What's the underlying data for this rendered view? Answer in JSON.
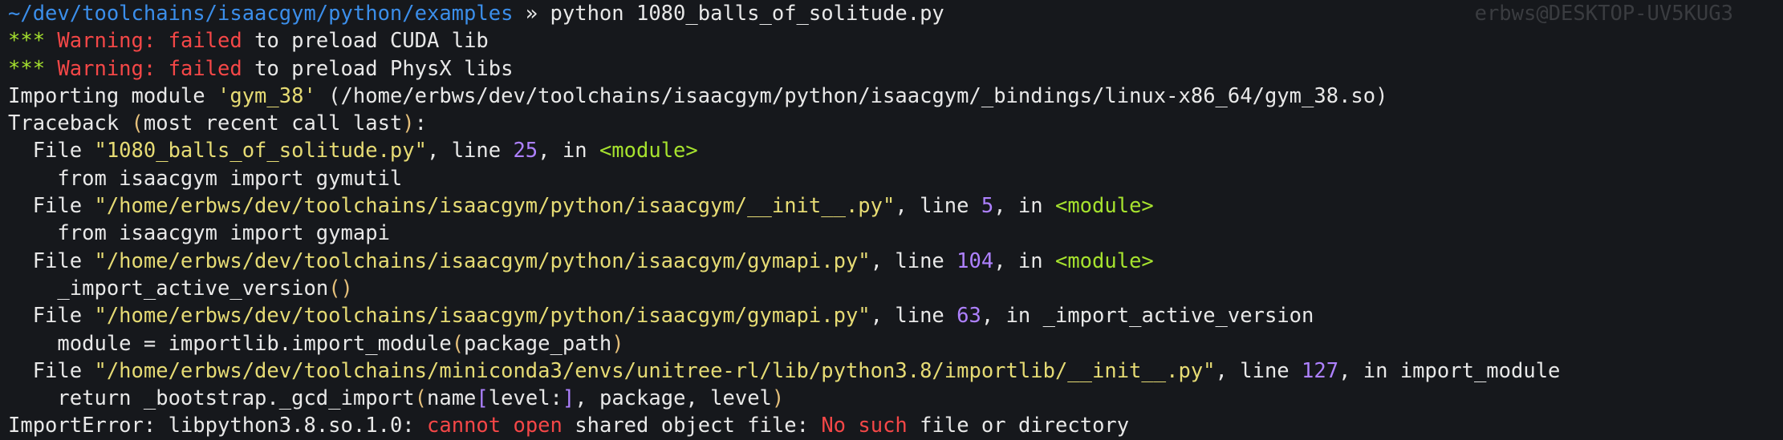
{
  "window": {
    "hostname": "erbws@DESKTOP-UV5KUG3"
  },
  "colors": {
    "background": "#16181c",
    "text": "#e8e8e8",
    "path": "#3b8eea",
    "asterisks": "#a6e22e",
    "error": "#f44747",
    "yellow": "#e5c07b",
    "string": "#e6db74",
    "number": "#ae81ff"
  },
  "prompt": {
    "cwd": "~/dev/toolchains/isaacgym/python/examples",
    "symbol": " » ",
    "command": "python 1080_balls_of_solitude.py"
  },
  "warnings": [
    {
      "stars": "***",
      "label": "Warning:",
      "keyword": "failed",
      "message": "to preload CUDA lib"
    },
    {
      "stars": "***",
      "label": "Warning:",
      "keyword": "failed",
      "message": "to preload PhysX libs"
    }
  ],
  "import_line": {
    "prefix": "Importing module ",
    "module": "'gym_38'",
    "location": " (/home/erbws/dev/toolchains/isaacgym/python/isaacgym/_bindings/linux-x86_64/gym_38.so)"
  },
  "traceback_header": {
    "word": "Traceback ",
    "paren_open": "(",
    "text": "most recent call last",
    "paren_close": ")",
    "colon": ":"
  },
  "frames": [
    {
      "file_prefix": "  File ",
      "file": "\"1080_balls_of_solitude.py\"",
      "line_prefix": ", line ",
      "line": "25",
      "in_prefix": ", in ",
      "func": "<module>",
      "code": "    from isaacgym import gymutil"
    },
    {
      "file_prefix": "  File ",
      "file": "\"/home/erbws/dev/toolchains/isaacgym/python/isaacgym/__init__.py\"",
      "line_prefix": ", line ",
      "line": "5",
      "in_prefix": ", in ",
      "func": "<module>",
      "code": "    from isaacgym import gymapi"
    },
    {
      "file_prefix": "  File ",
      "file": "\"/home/erbws/dev/toolchains/isaacgym/python/isaacgym/gymapi.py\"",
      "line_prefix": ", line ",
      "line": "104",
      "in_prefix": ", in ",
      "func": "<module>",
      "code": "    _import_active_version()"
    },
    {
      "file_prefix": "  File ",
      "file": "\"/home/erbws/dev/toolchains/isaacgym/python/isaacgym/gymapi.py\"",
      "line_prefix": ", line ",
      "line": "63",
      "in_prefix": ", in ",
      "func": "_import_active_version",
      "code": "    module = importlib.import_module(package_path)"
    },
    {
      "file_prefix": "  File ",
      "file": "\"/home/erbws/dev/toolchains/miniconda3/envs/unitree-rl/lib/python3.8/importlib/__init__.py\"",
      "line_prefix": ", line ",
      "line": "127",
      "in_prefix": ", in ",
      "func": "import_module",
      "code": "    return _bootstrap._gcd_import(name[level:], package, level)"
    }
  ],
  "error": {
    "type": "ImportError",
    "colon": ":",
    "lib": " libpython3.8.so.1.0:",
    "phrase1": "cannot open",
    "mid": " shared object file: ",
    "phrase2": "No such",
    "tail": " file or directory"
  }
}
